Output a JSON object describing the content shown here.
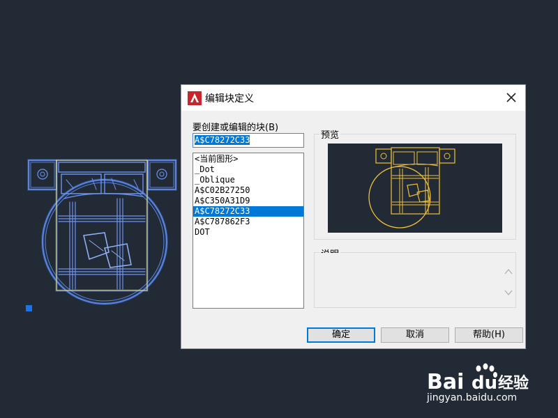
{
  "dialog": {
    "title": "编辑块定义",
    "block_label": "要创建或编辑的块(B)",
    "block_name": "A$C78272C33",
    "blocks": [
      "<当前图形>",
      "_Dot",
      "_Oblique",
      "A$C02B27250",
      "A$C350A31D9",
      "A$C78272C33",
      "A$C787862F3",
      "DOT"
    ],
    "selected_index": 5,
    "preview_label": "预览",
    "description_label": "说明",
    "buttons": {
      "ok": "确定",
      "cancel": "取消",
      "help": "帮助(H)"
    }
  },
  "watermark": {
    "logo_text": "Baidu经验",
    "url": "jingyan.baidu.com"
  },
  "colors": {
    "canvas_bg": "#222a35",
    "dialog_bg": "#f0f0f0",
    "selection": "#0078d7",
    "drawing_blue": "#4a7bd8",
    "drawing_yellow": "#f0c23a"
  }
}
